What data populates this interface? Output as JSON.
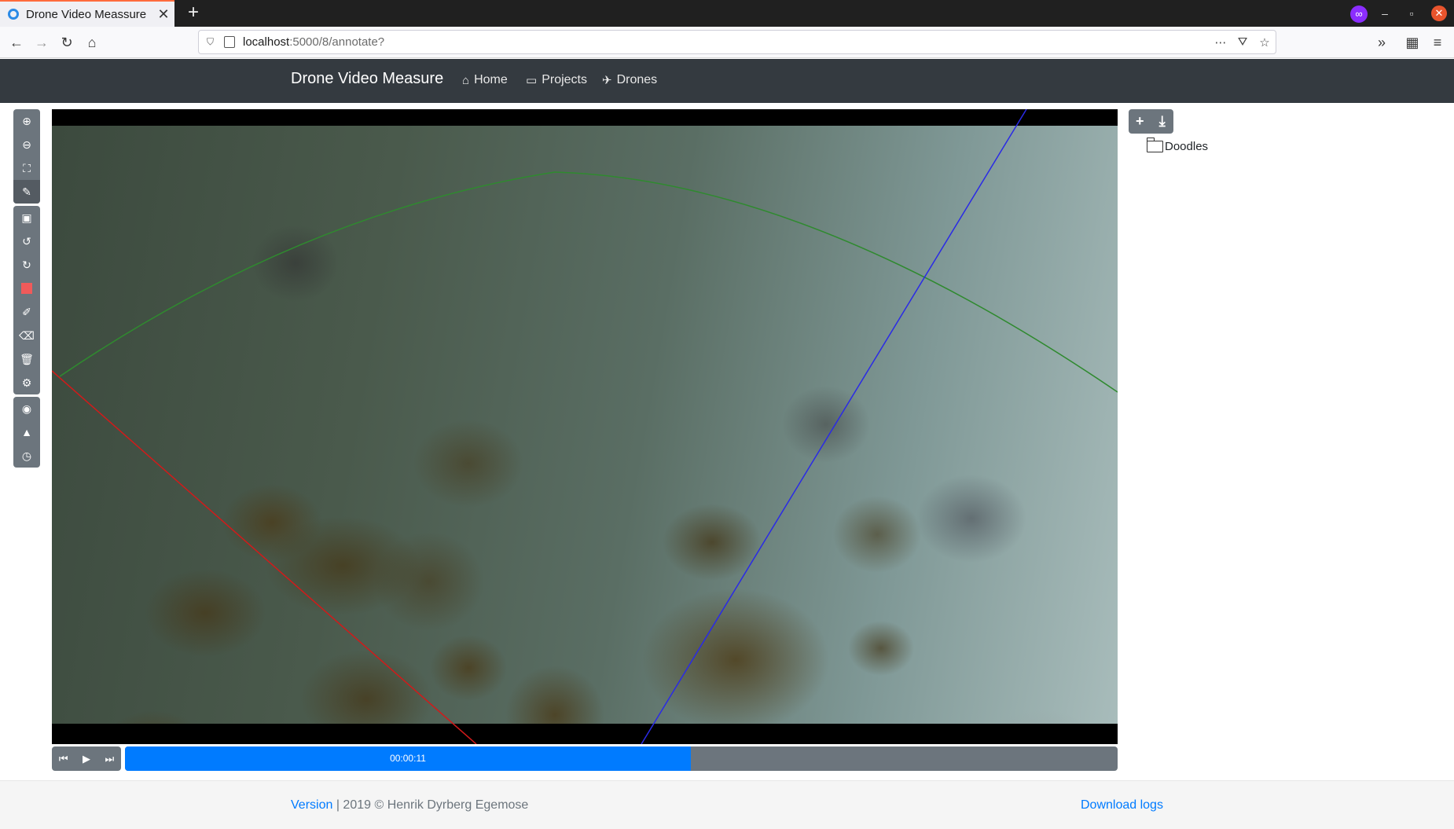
{
  "browser": {
    "tab_title": "Drone Video Meassure",
    "url_host": "localhost",
    "url_path": ":5000/8/annotate?"
  },
  "app": {
    "brand": "Drone Video Measure",
    "nav": [
      {
        "label": "Home",
        "icon": "home-icon"
      },
      {
        "label": "Projects",
        "icon": "folder-open-icon"
      },
      {
        "label": "Drones",
        "icon": "plane-icon"
      }
    ]
  },
  "toolbar": {
    "tools": [
      "zoom-in-icon",
      "zoom-out-icon",
      "fit-screen-icon",
      "edit-icon",
      "save-icon",
      "undo-icon",
      "redo-icon",
      "color-swatch",
      "pencil-icon",
      "eraser-icon",
      "trash-icon",
      "settings-icon",
      "compass-icon",
      "chart-icon",
      "clock-icon"
    ],
    "swatch_color": "#f05a5a"
  },
  "video": {
    "overlay_colors": {
      "red_line": "#d21a1a",
      "blue_line": "#2a2ae6",
      "green_arc": "#2f8a2f"
    }
  },
  "player": {
    "time": "00:00:11",
    "progress": 0.57
  },
  "annotations": {
    "tree": [
      {
        "label": "Doodles",
        "icon": "folder-icon"
      }
    ]
  },
  "footer": {
    "version_link": "Version",
    "copyright": " | 2019 © Henrik Dyrberg Egemose",
    "download_logs": "Download logs"
  }
}
